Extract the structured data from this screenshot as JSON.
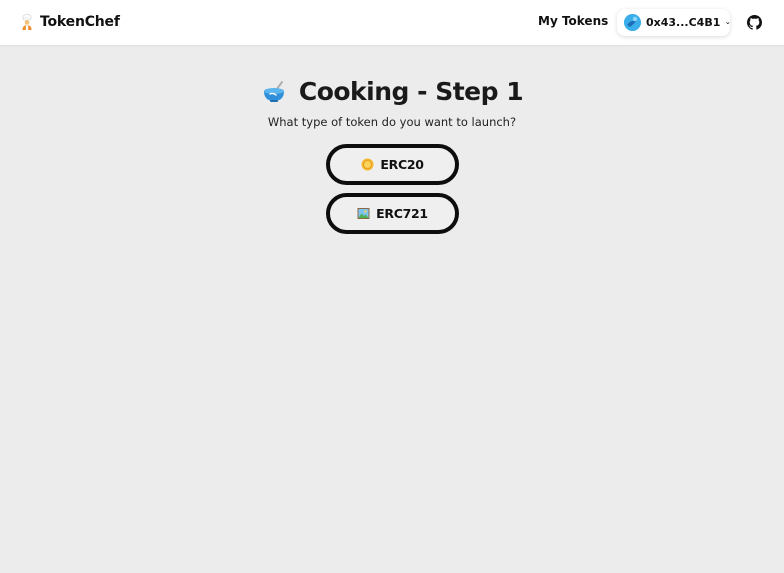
{
  "header": {
    "brand_name": "TokenChef",
    "nav_my_tokens": "My Tokens",
    "wallet_address": "0x43...C4B1"
  },
  "main": {
    "title": "Cooking - Step 1",
    "subtitle": "What type of token do you want to launch?",
    "options": [
      {
        "label": "ERC20",
        "icon": "coin-icon"
      },
      {
        "label": "ERC721",
        "icon": "picture-icon"
      }
    ]
  },
  "colors": {
    "background": "#ececec",
    "header_background": "#ffffff",
    "text": "#111111",
    "button_border": "#0d0d0d",
    "wallet_avatar": "#3aaee8"
  }
}
